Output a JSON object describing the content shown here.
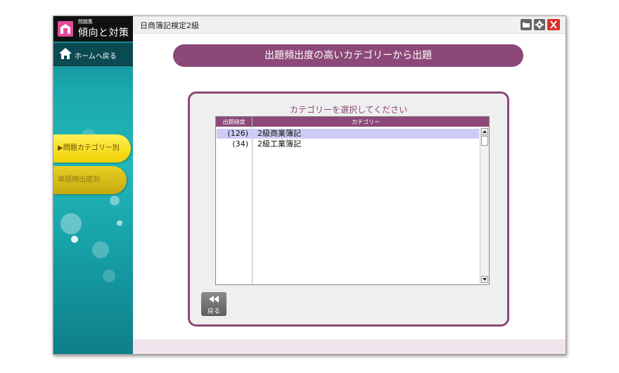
{
  "app": {
    "subtitle": "問題集",
    "name": "傾向と対策",
    "logo_icon": "home-building-icon"
  },
  "window": {
    "title": "日商簿記検定2級",
    "buttons": {
      "open_icon": "folder-icon",
      "settings_icon": "gear-icon",
      "close_icon": "close-icon"
    }
  },
  "sidebar": {
    "home_label": "ホームへ戻る",
    "home_icon": "house-icon",
    "items": [
      {
        "label": "▶問題カテゴリー別",
        "active": true
      },
      {
        "label": "単語頻出度別",
        "active": false
      }
    ]
  },
  "main": {
    "banner": "出題頻出度の高いカテゴリーから出題",
    "panel_title": "カテゴリーを選択してください",
    "columns": {
      "frequency": "出題頻度",
      "category": "カテゴリー"
    },
    "rows": [
      {
        "freq": "(126)",
        "category": "2級商業簿記",
        "selected": true
      },
      {
        "freq": "(34)",
        "category": "2級工業簿記",
        "selected": false
      }
    ],
    "back_label": "戻る",
    "back_icon": "rewind-icon"
  },
  "colors": {
    "accent": "#8c4878",
    "sidebar": "#1aa9b0",
    "active_tab": "#f0d000",
    "selection": "#ccccf4"
  }
}
